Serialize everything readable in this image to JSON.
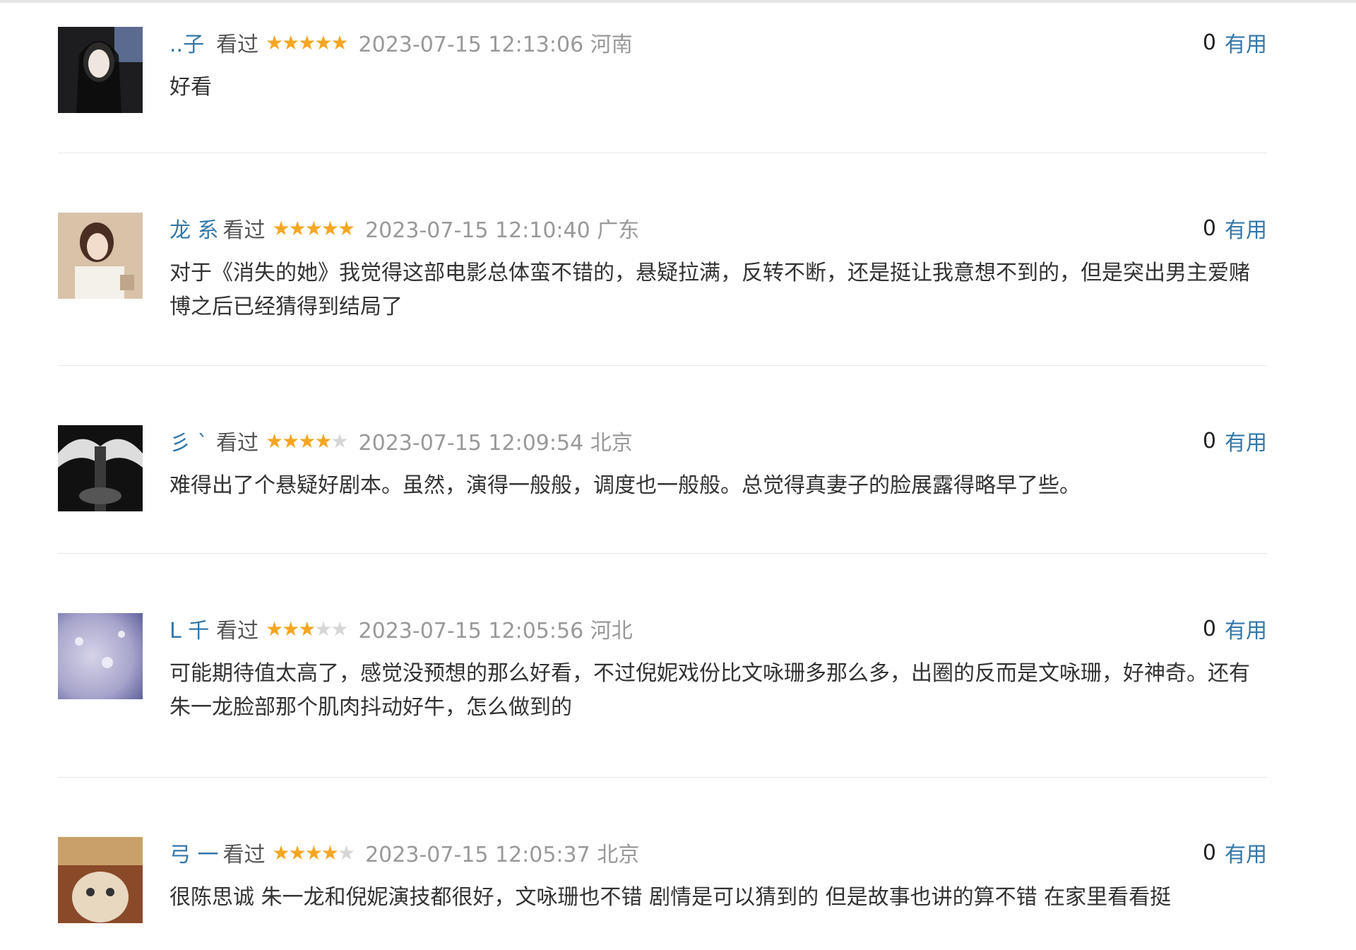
{
  "reviews": [
    {
      "user": "..子",
      "watched": "看过",
      "rating": 5,
      "time": "2023-07-15 12:13:06 河南",
      "useful_count": "0",
      "useful_label": "有用",
      "content": "好看",
      "avatar_colors": [
        "#1d1d1f",
        "#6a6e82",
        "#e8e2dc"
      ]
    },
    {
      "user": "龙 系",
      "watched": "看过",
      "rating": 5,
      "time": "2023-07-15 12:10:40 广东",
      "useful_count": "0",
      "useful_label": "有用",
      "content": "对于《消失的她》我觉得这部电影总体蛮不错的，悬疑拉满，反转不断，还是挺让我意想不到的，但是突出男主爱赌博之后已经猜得到结局了",
      "avatar_colors": [
        "#d8c2a8",
        "#6b4a3a",
        "#f2e6da"
      ]
    },
    {
      "user": "彡 `",
      "watched": "看过",
      "rating": 4,
      "time": "2023-07-15 12:09:54 北京",
      "useful_count": "0",
      "useful_label": "有用",
      "content": "难得出了个悬疑好剧本。虽然，演得一般般，调度也一般般。总觉得真妻子的脸展露得略早了些。",
      "avatar_colors": [
        "#111111",
        "#7a7a7a",
        "#dddddd"
      ]
    },
    {
      "user": "L 千",
      "watched": "看过",
      "rating": 3,
      "time": "2023-07-15 12:05:56 河北",
      "useful_count": "0",
      "useful_label": "有用",
      "content": "可能期待值太高了，感觉没预想的那么好看，不过倪妮戏份比文咏珊多那么多，出圈的反而是文咏珊，好神奇。还有朱一龙脸部那个肌肉抖动好牛，怎么做到的",
      "avatar_colors": [
        "#6d6fa8",
        "#a7a4cc",
        "#d6d3e8"
      ]
    },
    {
      "user": "弓 一",
      "watched": "看过",
      "rating": 4,
      "time": "2023-07-15 12:05:37 北京",
      "useful_count": "0",
      "useful_label": "有用",
      "content": "很陈思诚 朱一龙和倪妮演技都很好，文咏珊也不错 剧情是可以猜到的 但是故事也讲的算不错 在家里看看挺",
      "avatar_colors": [
        "#c9a06a",
        "#8a4a2a",
        "#e8d8c0"
      ]
    }
  ]
}
